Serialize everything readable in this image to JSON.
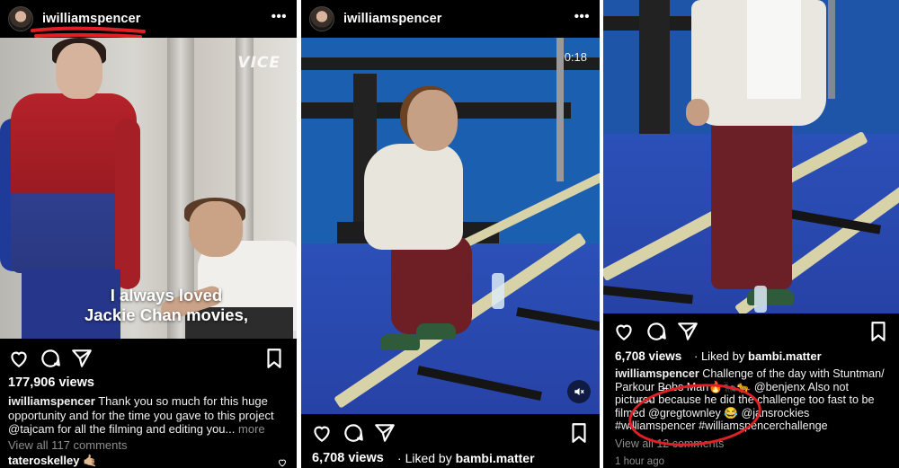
{
  "panels": [
    {
      "username": "iwilliamspencer",
      "watermark": "VICE",
      "subtitle_line1": "I always loved",
      "subtitle_line2": "Jackie Chan movies,",
      "views": "177,906 views",
      "caption_user": "iwilliamspencer",
      "caption_text": "Thank you so much for this huge opportunity and for the time you gave to this project @tajcam  for all the filming and editing you...",
      "more": "more",
      "view_comments": "View all 117 comments",
      "commenter": "tateroskelley 🤙🏼"
    },
    {
      "username": "iwilliamspencer",
      "timecode": "0:18",
      "views": "6,708 views",
      "liked_by_prefix": "Liked by",
      "liked_by_user": "bambi.matter"
    },
    {
      "views": "6,708 views",
      "liked_by_prefix": "Liked by",
      "liked_by_user": "bambi.matter",
      "caption_user": "iwilliamspencer",
      "caption_l1": "Challenge of the day with Stuntman/",
      "caption_l2": "Parkour B̶obs Man🔥🐜🐆 @benjenx  Also not",
      "caption_l3": "pictu̶r̶e̶d because he did the challenge too fast to be",
      "caption_l4": "filmed @gregtownley 😂 @jansrockies",
      "caption_l5": "#wi̶lliamspencer #williamspencerchallenge",
      "view_comments": "View all 12 comments",
      "time": "1 hour ago"
    }
  ],
  "icons": {
    "menu": "more-dots-icon",
    "like": "heart-icon",
    "comment": "comment-icon",
    "share": "send-icon",
    "save": "bookmark-icon",
    "mute": "muted-speaker-icon"
  },
  "colors": {
    "annotation_red": "#e02024",
    "background": "#000000",
    "muted_text": "#8e8e8e"
  }
}
